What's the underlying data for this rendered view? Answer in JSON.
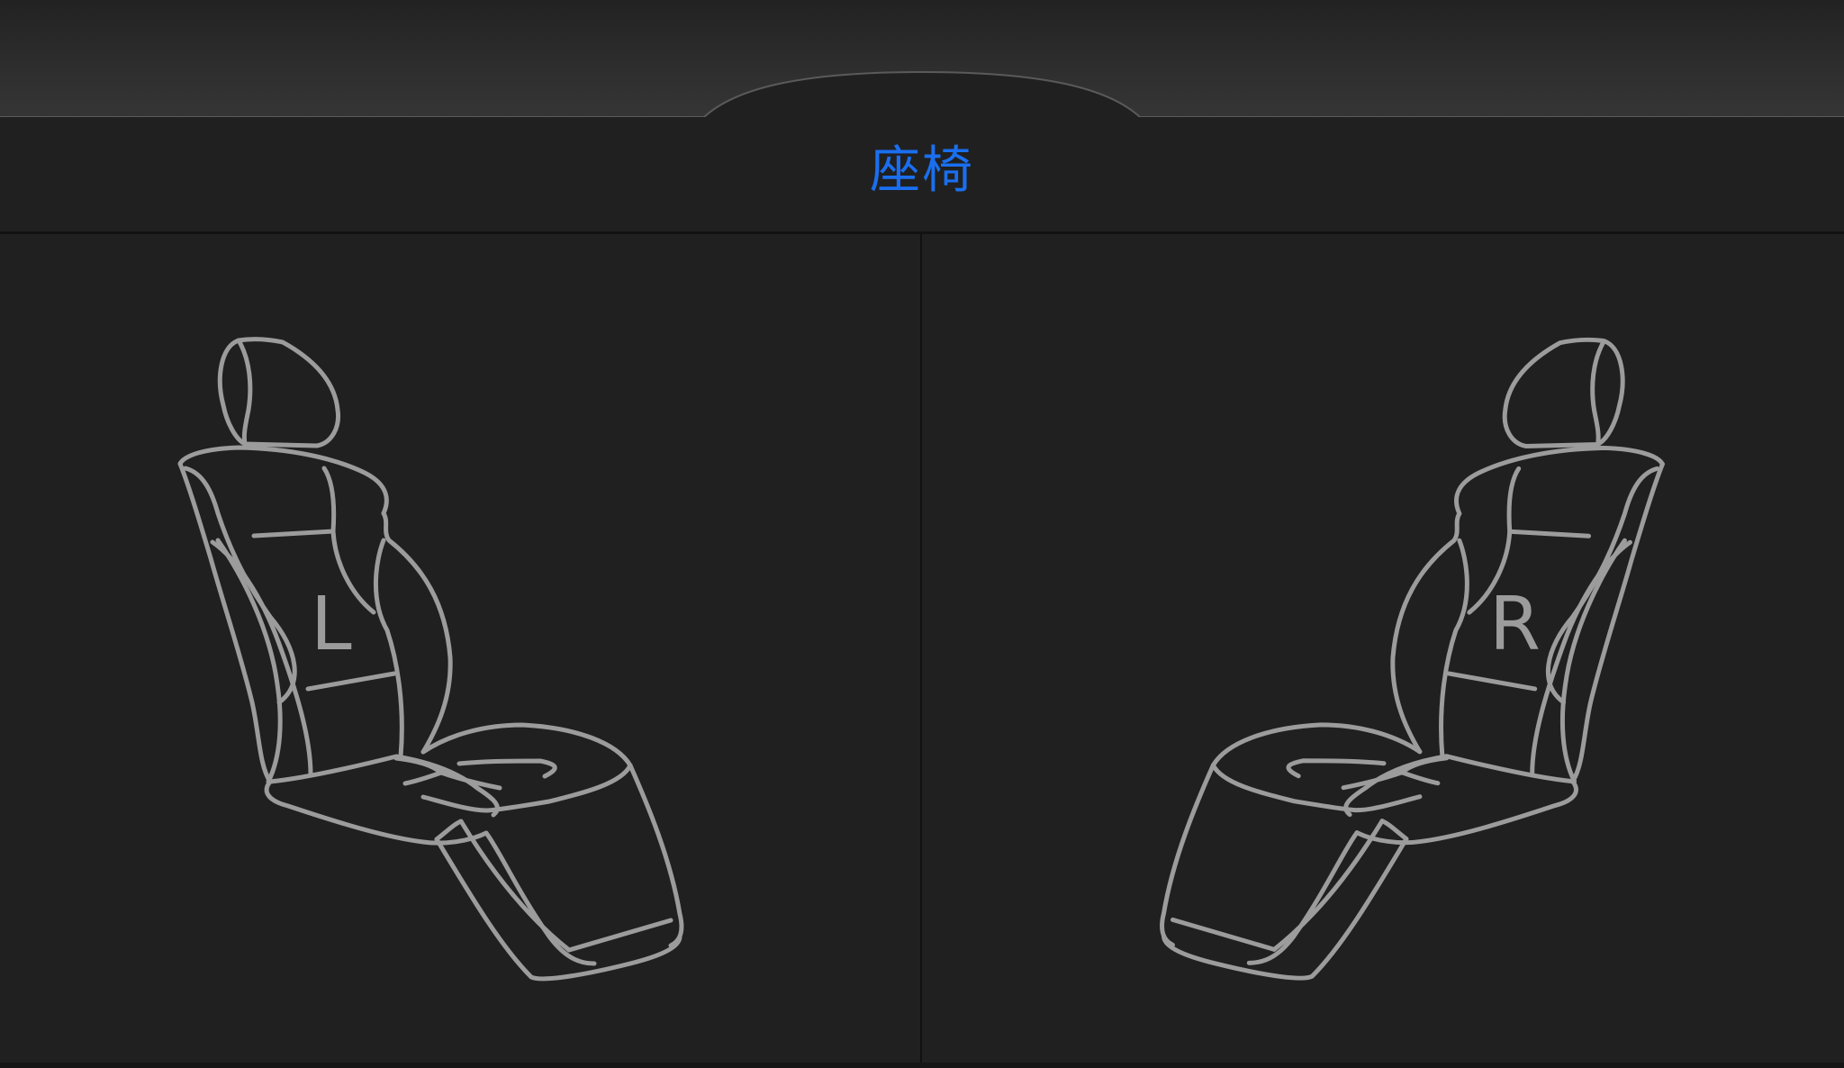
{
  "header": {
    "title": "座椅"
  },
  "seats": {
    "left": {
      "label": "L"
    },
    "right": {
      "label": "R"
    }
  },
  "colors": {
    "title": "#1a6ff0",
    "seat_outline": "#9c9c9c",
    "background": "#202020"
  }
}
